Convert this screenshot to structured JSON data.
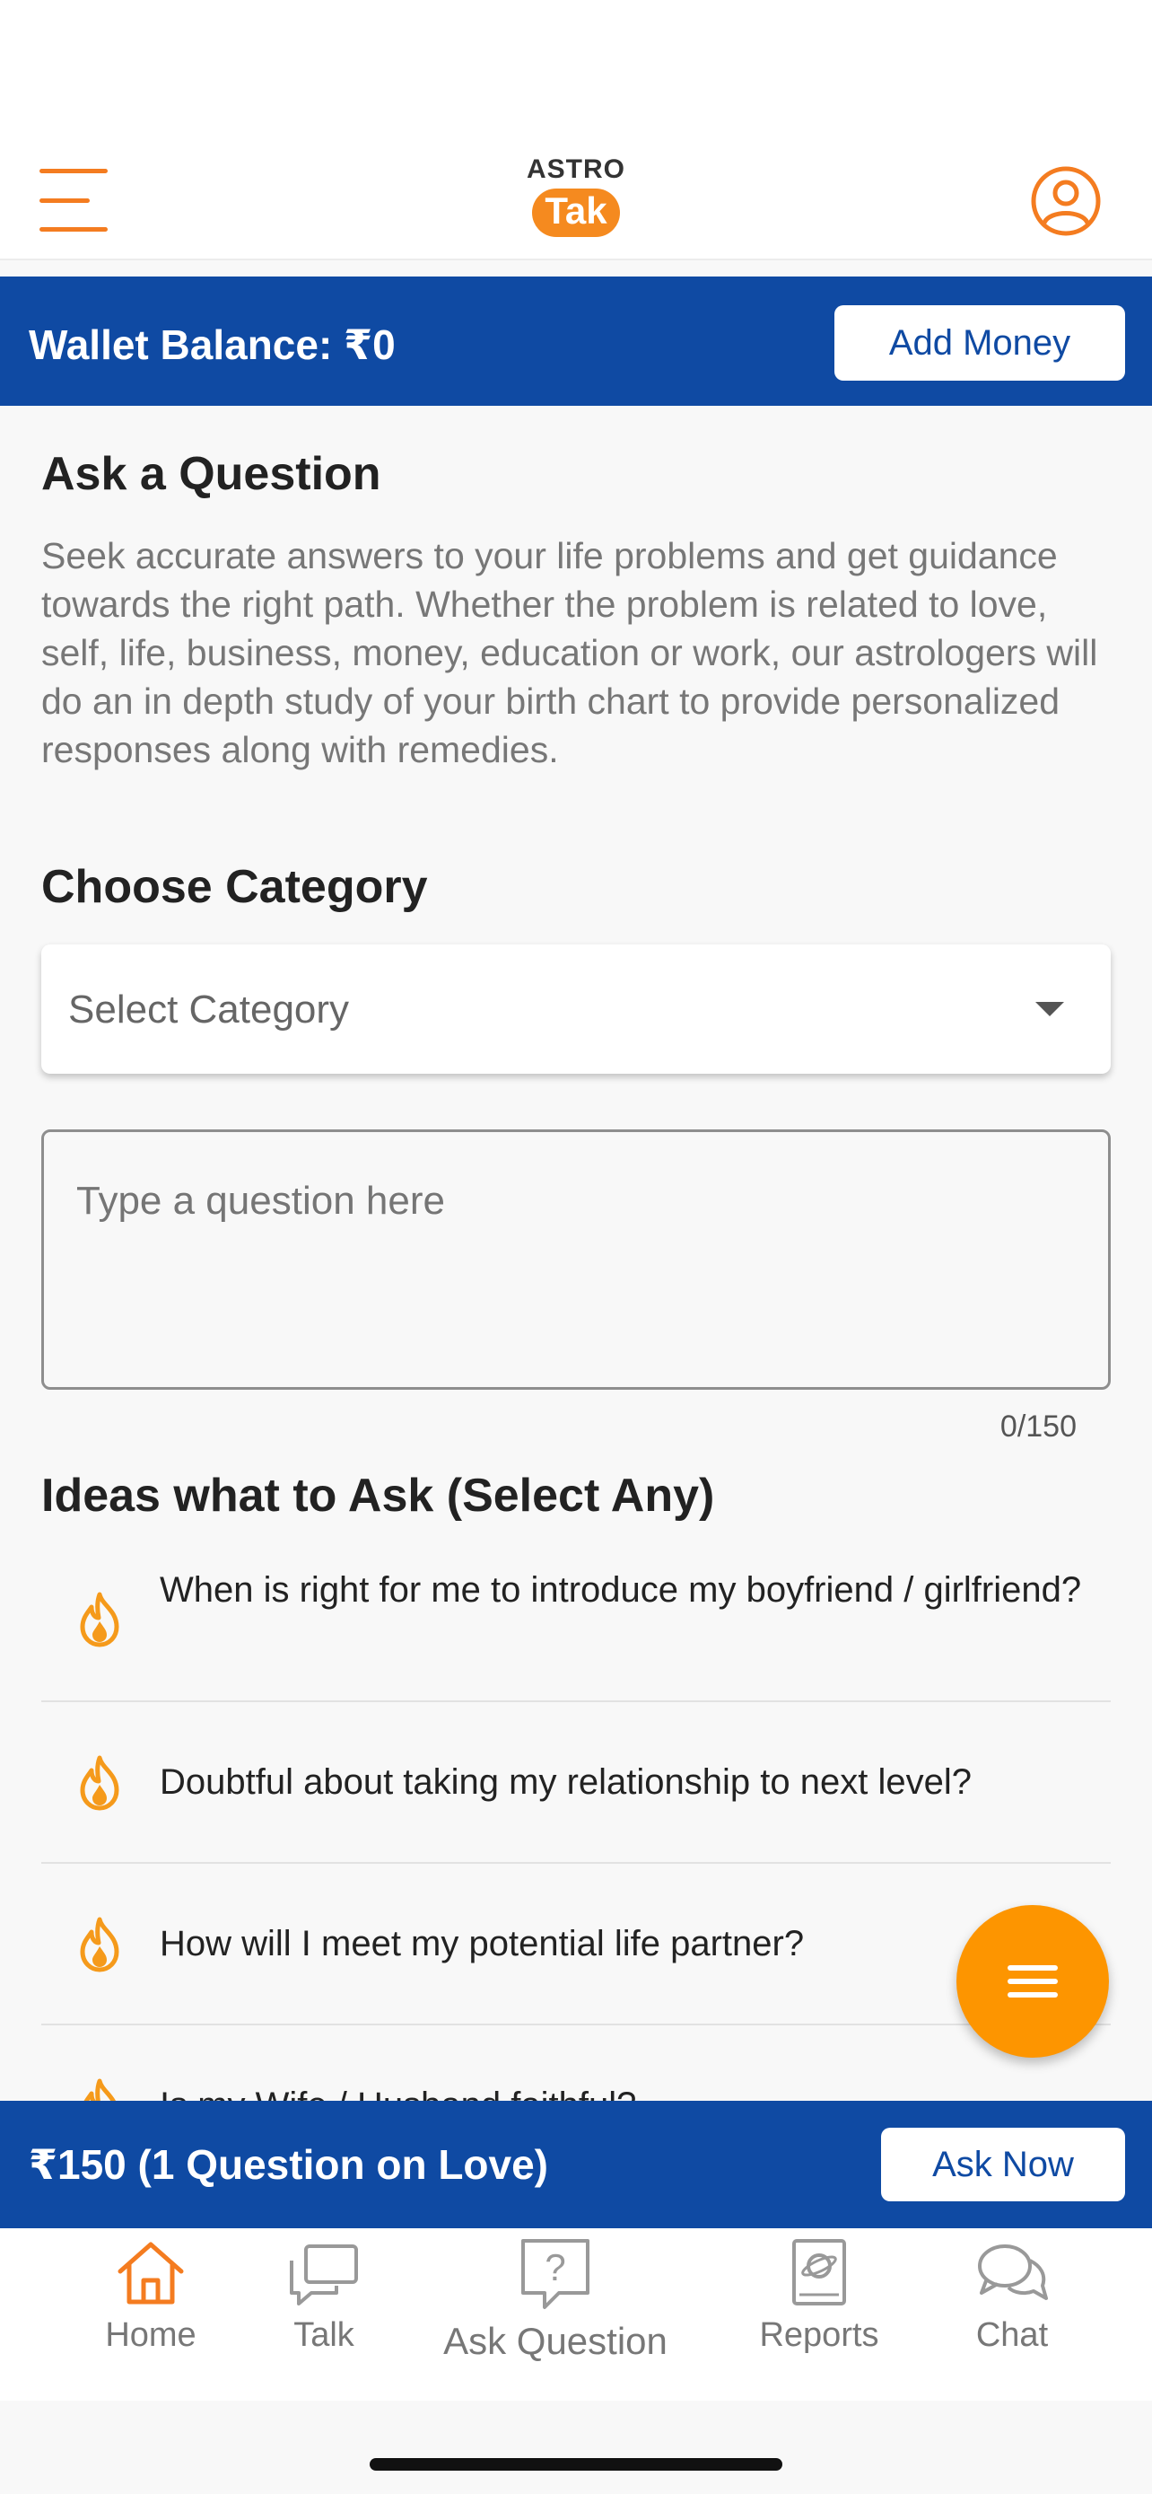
{
  "header": {
    "logo_top": "ASTRO",
    "logo_bottom": "Tak",
    "brand_color": "#f58a1f"
  },
  "wallet": {
    "balance_label": "Wallet Balance: ₹0",
    "add_money_label": "Add Money",
    "bar_color": "#0f4aa3"
  },
  "ask": {
    "title": "Ask a Question",
    "description": "Seek accurate answers to your life problems and get guidance towards the right path. Whether the problem is related to love, self, life, business, money, education or work, our astrologers will do an in depth study of your birth chart to provide personalized responses along with remedies.",
    "category_title": "Choose Category",
    "category_placeholder": "Select Category",
    "question_placeholder": "Type a question here",
    "counter": "0/150"
  },
  "ideas": {
    "title": "Ideas what to Ask (Select Any)",
    "items": [
      "When is right for me to introduce my boyfriend / girlfriend?",
      "Doubtful about taking my relationship to next level?",
      "How will I meet my potential life partner?",
      "Is my Wife / Husband faithful?"
    ]
  },
  "askbar": {
    "price_label": "₹150 (1 Question on Love)",
    "ask_now_label": "Ask Now"
  },
  "nav": {
    "items": [
      {
        "label": "Home",
        "icon": "home-icon",
        "active": true
      },
      {
        "label": "Talk",
        "icon": "talk-icon",
        "active": false
      },
      {
        "label": "Ask Question",
        "icon": "ask-question-icon",
        "active": false
      },
      {
        "label": "Reports",
        "icon": "reports-icon",
        "active": false
      },
      {
        "label": "Chat",
        "icon": "chat-icon",
        "active": false
      }
    ]
  },
  "colors": {
    "accent": "#fd9500",
    "flame": "#f59a1b"
  }
}
